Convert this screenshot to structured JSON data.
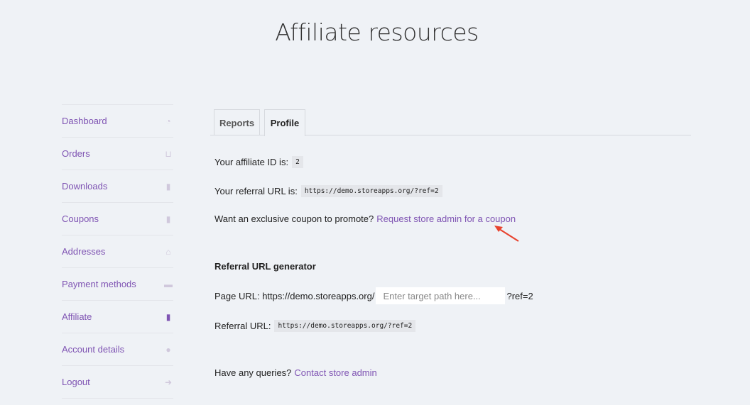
{
  "title": "Affiliate resources",
  "nav": [
    {
      "label": "Dashboard",
      "icon": "dashboard-icon",
      "glyph": "◔"
    },
    {
      "label": "Orders",
      "icon": "basket-icon",
      "glyph": "⊔"
    },
    {
      "label": "Downloads",
      "icon": "file-download-icon",
      "glyph": "▮"
    },
    {
      "label": "Coupons",
      "icon": "file-icon",
      "glyph": "▮"
    },
    {
      "label": "Addresses",
      "icon": "home-icon",
      "glyph": "⌂"
    },
    {
      "label": "Payment methods",
      "icon": "credit-card-icon",
      "glyph": "▬"
    },
    {
      "label": "Affiliate",
      "icon": "file-text-icon",
      "glyph": "▮"
    },
    {
      "label": "Account details",
      "icon": "user-icon",
      "glyph": "●"
    },
    {
      "label": "Logout",
      "icon": "sign-out-icon",
      "glyph": "➜"
    }
  ],
  "tabs": {
    "reports": "Reports",
    "profile": "Profile"
  },
  "profile": {
    "affiliate_id_label": "Your affiliate ID is:",
    "affiliate_id": "2",
    "referral_url_label": "Your referral URL is:",
    "referral_url": "https://demo.storeapps.org/?ref=2",
    "coupon_text": "Want an exclusive coupon to promote?",
    "coupon_link": "Request store admin for a coupon",
    "generator_title": "Referral URL generator",
    "page_url_label": "Page URL: https://demo.storeapps.org/",
    "page_url_placeholder": "Enter target path here...",
    "page_url_suffix": "?ref=2",
    "generated_label": "Referral URL:",
    "generated_url": "https://demo.storeapps.org/?ref=2",
    "queries_text": "Have any queries?",
    "contact_link": "Contact store admin"
  },
  "colors": {
    "accent": "#7f54b3",
    "arrow": "#e8432e"
  }
}
